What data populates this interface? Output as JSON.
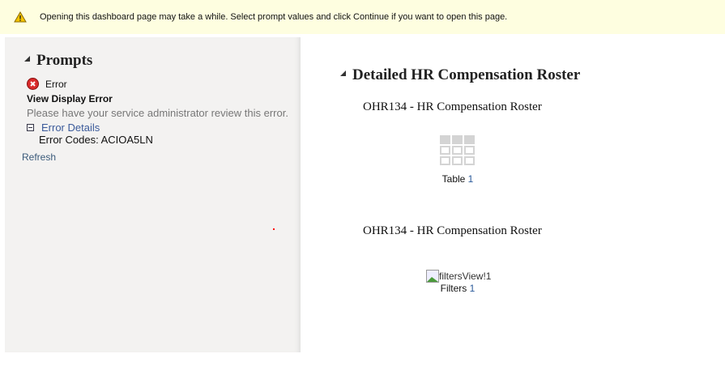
{
  "banner": {
    "icon": "warning-icon",
    "text": "Opening this dashboard page may take a while. Select prompt values and click Continue if you want to open this page."
  },
  "prompts": {
    "title": "Prompts",
    "error_label": "Error",
    "error_title": "View Display Error",
    "error_message": "Please have your service administrator review this error.",
    "details_label": "Error Details",
    "error_codes": "Error Codes: ACIOA5LN",
    "refresh": "Refresh"
  },
  "main": {
    "title": "Detailed HR Compensation Roster",
    "section1": "OHR134 - HR Compensation Roster",
    "table_label": "Table",
    "table_num": "1",
    "section2": "OHR134 - HR Compensation Roster",
    "filters_alt": "filtersView!1",
    "filters_label": "Filters",
    "filters_num": "1"
  }
}
